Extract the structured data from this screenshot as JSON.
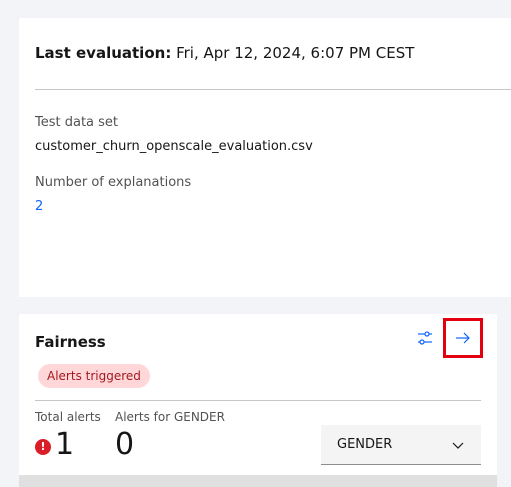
{
  "evaluation": {
    "last_label": "Last evaluation:",
    "last_value": "Fri, Apr 12, 2024, 6:07 PM CEST",
    "test_set_label": "Test data set",
    "test_set_value": "customer_churn_openscale_evaluation.csv",
    "explanations_label": "Number of explanations",
    "explanations_value": "2"
  },
  "fairness": {
    "title": "Fairness",
    "tag": "Alerts triggered",
    "total_alerts_label": "Total alerts",
    "total_alerts_value": "1",
    "alert_icon_glyph": "!",
    "gender_alerts_label": "Alerts for GENDER",
    "gender_alerts_value": "0",
    "attribute_select_value": "GENDER",
    "icons": {
      "configure": "sliders-icon",
      "open": "arrow-right-icon",
      "select_caret": "chevron-down-icon",
      "alert": "error-filled-icon"
    }
  },
  "colors": {
    "link": "#0f62fe",
    "tag_bg": "#ffd7d9",
    "tag_text": "#a2191f",
    "alert": "#da1e28",
    "highlight_box": "#e3000f"
  }
}
